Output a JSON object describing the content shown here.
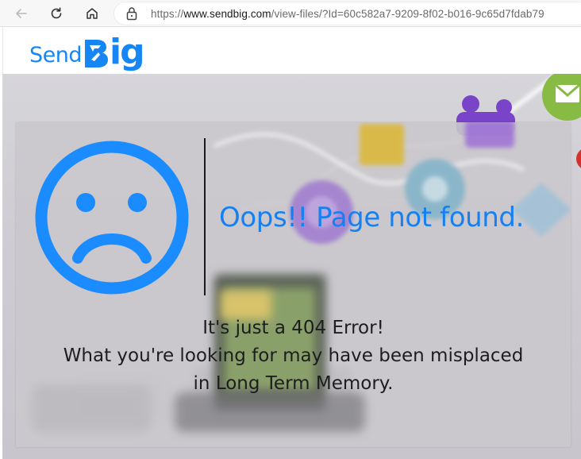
{
  "browser": {
    "url_prefix": "https://",
    "url_domain": "www.sendbig.com",
    "url_path": "/view-files/?Id=60c582a7-9209-8f02-b016-9c65d7fdab79",
    "icons": {
      "back": "arrow-left-icon",
      "reload": "reload-icon",
      "home": "home-icon",
      "lock": "lock-icon"
    }
  },
  "header": {
    "logo_send": "Send",
    "logo_big": "ig"
  },
  "error": {
    "title": "Oops!! Page not found.",
    "line1": "It's just a 404 Error!",
    "line2": "What you're looking for may have been misplaced",
    "line3": "in Long Term Memory."
  },
  "colors": {
    "brand_blue": "#1686f5",
    "face_blue": "#1a8cff",
    "title_blue": "#1780f0",
    "text": "#1d1d1d"
  }
}
